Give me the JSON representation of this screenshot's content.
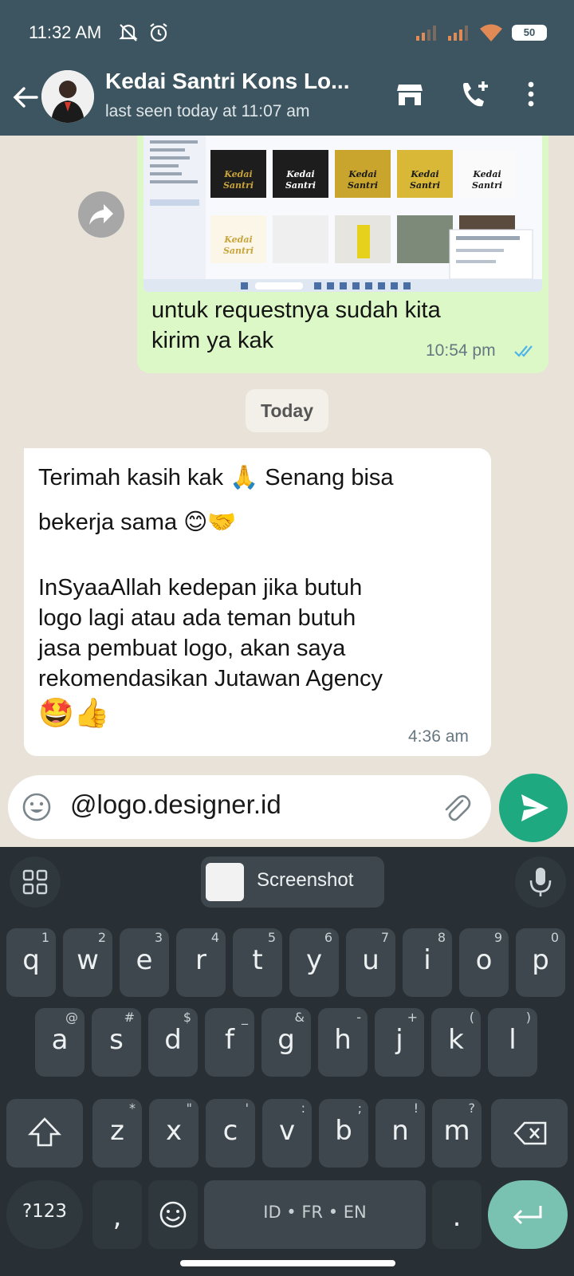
{
  "status_bar": {
    "time": "11:32 AM",
    "battery": "50"
  },
  "app_bar": {
    "contact_name": "Kedai Santri Kons Lo...",
    "last_seen": "last seen today at 11:07 am"
  },
  "chat": {
    "outgoing": {
      "text_line1": "untuk requestnya sudah kita",
      "text_line2": "kirim ya kak",
      "time": "10:54 pm",
      "image_thumb_label": "Kedai Santri"
    },
    "date_chip": "Today",
    "incoming": {
      "line1": "Terimah kasih kak 🙏 Senang bisa",
      "line2": "bekerja sama 😊🤝",
      "line3": "InSyaaAllah kedepan jika butuh",
      "line4": "logo lagi atau ada teman butuh",
      "line5": "jasa pembuat logo, akan saya",
      "line6": "rekomendasikan Jutawan Agency",
      "line7": "🤩👍",
      "time": "4:36 am"
    }
  },
  "composer": {
    "value": "@logo.designer.id"
  },
  "keyboard": {
    "suggestion": "Screenshot",
    "row1": [
      {
        "k": "q",
        "s": "1"
      },
      {
        "k": "w",
        "s": "2"
      },
      {
        "k": "e",
        "s": "3"
      },
      {
        "k": "r",
        "s": "4"
      },
      {
        "k": "t",
        "s": "5"
      },
      {
        "k": "y",
        "s": "6"
      },
      {
        "k": "u",
        "s": "7"
      },
      {
        "k": "i",
        "s": "8"
      },
      {
        "k": "o",
        "s": "9"
      },
      {
        "k": "p",
        "s": "0"
      }
    ],
    "row2": [
      {
        "k": "a",
        "s": "@"
      },
      {
        "k": "s",
        "s": "#"
      },
      {
        "k": "d",
        "s": "$"
      },
      {
        "k": "f",
        "s": "_"
      },
      {
        "k": "g",
        "s": "&"
      },
      {
        "k": "h",
        "s": "-"
      },
      {
        "k": "j",
        "s": "+"
      },
      {
        "k": "k",
        "s": "("
      },
      {
        "k": "l",
        "s": ")"
      }
    ],
    "row3": [
      {
        "k": "z",
        "s": "*"
      },
      {
        "k": "x",
        "s": "\""
      },
      {
        "k": "c",
        "s": "'"
      },
      {
        "k": "v",
        "s": ":"
      },
      {
        "k": "b",
        "s": ";"
      },
      {
        "k": "n",
        "s": "!"
      },
      {
        "k": "m",
        "s": "?"
      }
    ],
    "symbols_label": "?123",
    "comma": ",",
    "space_label": "ID • FR • EN",
    "period": "."
  },
  "colors": {
    "header": "#3c5560",
    "outgoing_bubble": "#dcf8c6",
    "send": "#1ea981",
    "keyboard": "#283035"
  }
}
